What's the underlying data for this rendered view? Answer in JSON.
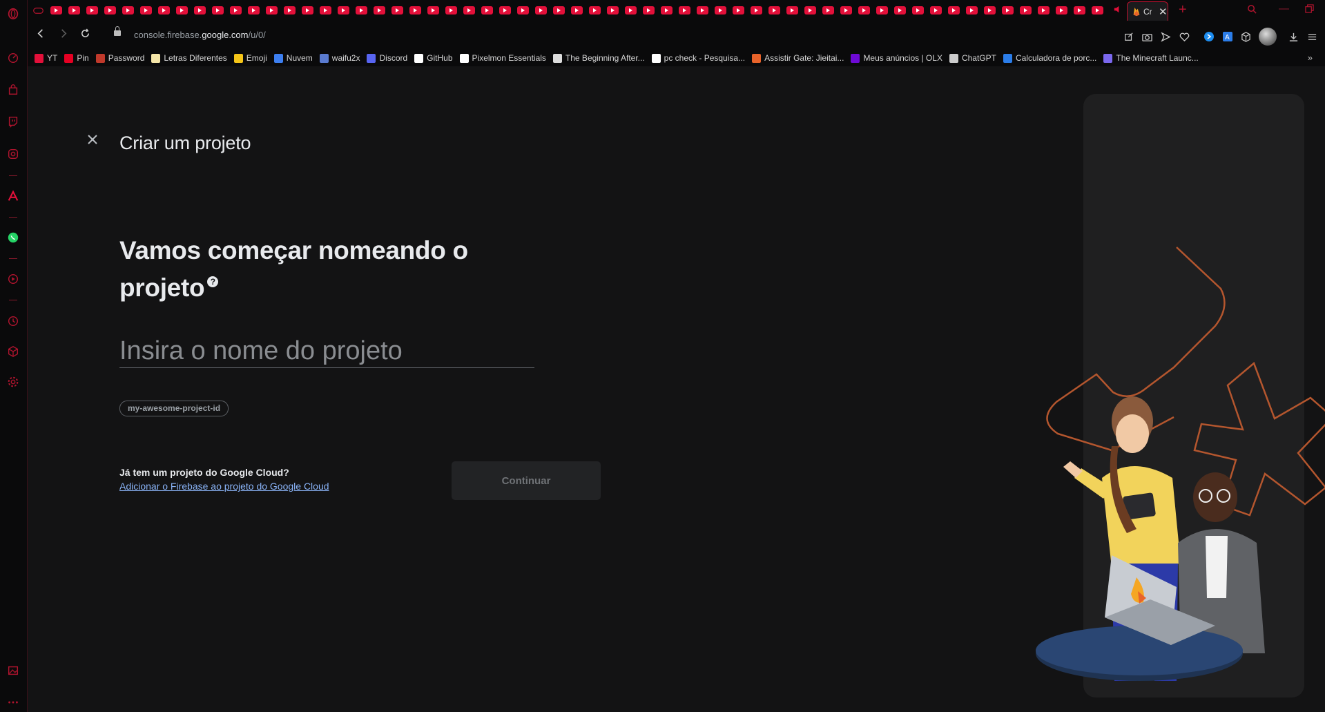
{
  "browser": {
    "active_tab": {
      "title": "Cr",
      "icon": "firebase-icon"
    },
    "address": {
      "url_prefix": "console.firebase.",
      "url_domain": "google.com",
      "url_suffix": "/u/0/"
    },
    "bookmarks": [
      {
        "label": "YT",
        "icon": "youtube-icon",
        "color": "#e3103a"
      },
      {
        "label": "Pin",
        "icon": "pinterest-icon",
        "color": "#e60023"
      },
      {
        "label": "Password",
        "icon": "password-icon",
        "color": "#c0392b"
      },
      {
        "label": "Letras Diferentes",
        "icon": "note-icon",
        "color": "#f5e6a8"
      },
      {
        "label": "Emoji",
        "icon": "emoji-icon",
        "color": "#f5c518"
      },
      {
        "label": "Nuvem",
        "icon": "dropbox-icon",
        "color": "#3d7ff0"
      },
      {
        "label": "waifu2x",
        "icon": "waifu2x-icon",
        "color": "#5a7bd0"
      },
      {
        "label": "Discord",
        "icon": "discord-icon",
        "color": "#5865f2"
      },
      {
        "label": "GitHub",
        "icon": "github-icon",
        "color": "#ffffff"
      },
      {
        "label": "Pixelmon Essentials",
        "icon": "page-icon",
        "color": "#ffffff"
      },
      {
        "label": "The Beginning After...",
        "icon": "book-icon",
        "color": "#dddddd"
      },
      {
        "label": "pc check - Pesquisa...",
        "icon": "google-icon",
        "color": "#ffffff"
      },
      {
        "label": "Assistir Gate: Jieitai...",
        "icon": "anime-icon",
        "color": "#e8632a"
      },
      {
        "label": "Meus anúncios | OLX",
        "icon": "olx-icon",
        "color": "#6e0ad6"
      },
      {
        "label": "ChatGPT",
        "icon": "chatgpt-icon",
        "color": "#cccccc"
      },
      {
        "label": "Calculadora de porc...",
        "icon": "calculator-icon",
        "color": "#2b7de9"
      },
      {
        "label": "The Minecraft Launc...",
        "icon": "minecraft-icon",
        "color": "#7b68ee"
      }
    ]
  },
  "page": {
    "title": "Criar um projeto",
    "headline": "Vamos começar nomeando o projeto",
    "help_glyph": "?",
    "name_input": {
      "value": "",
      "placeholder": "Insira o nome do projeto"
    },
    "project_id_chip": "my-awesome-project-id",
    "google_cloud_question": "Já tem um projeto do Google Cloud?",
    "google_cloud_link": "Adicionar o Firebase ao projeto do Google Cloud",
    "continue_button": "Continuar"
  },
  "colors": {
    "accent": "#e3103a",
    "link": "#8ab4f8",
    "background": "#131314"
  }
}
